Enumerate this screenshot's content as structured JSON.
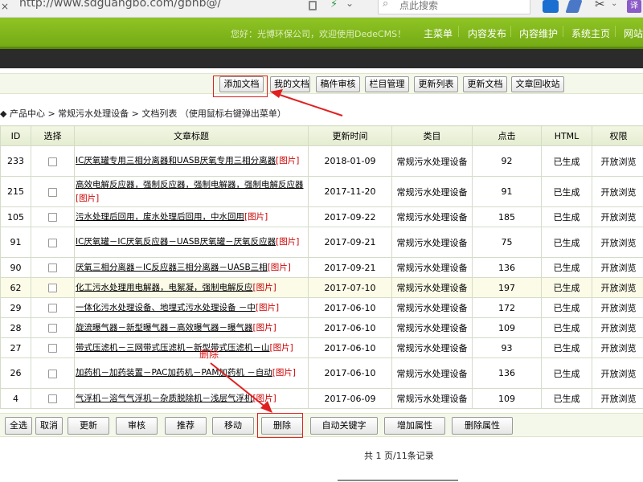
{
  "browser": {
    "url": "http://www.sdguangbo.com/gbhb@/",
    "search_placeholder": "点此搜索",
    "ext_translate": "译"
  },
  "header": {
    "welcome": "您好：光博环保公司，欢迎使用DedeCMS！",
    "nav": [
      "主菜单",
      "内容发布",
      "内容维护",
      "系统主页",
      "网站"
    ]
  },
  "toolbar": {
    "buttons": [
      "添加文档",
      "我的文档",
      "稿件审核",
      "栏目管理",
      "更新列表",
      "更新文档",
      "文章回收站"
    ]
  },
  "breadcrumb": {
    "text": "◆ 产品中心 > 常规污水处理设备 > 文档列表 （使用鼠标右键弹出菜单）"
  },
  "table": {
    "headers": [
      "ID",
      "选择",
      "文章标题",
      "更新时间",
      "类目",
      "点击",
      "HTML",
      "权限"
    ],
    "img_tag": "[图片]",
    "rows": [
      {
        "id": "233",
        "title": "IC厌氧罐专用三相分离器和UASB厌氧专用三相分离器",
        "date": "2018-01-09",
        "cat": "常规污水处理设备",
        "clicks": "92",
        "html": "已生成",
        "perm": "开放浏览"
      },
      {
        "id": "215",
        "title": "高效电解反应器，强制反应器，强制电解器，强制电解反应器",
        "date": "2017-11-20",
        "cat": "常规污水处理设备",
        "clicks": "91",
        "html": "已生成",
        "perm": "开放浏览"
      },
      {
        "id": "105",
        "title": "污水处理后回用，废水处理后回用，中水回用",
        "date": "2017-09-22",
        "cat": "常规污水处理设备",
        "clicks": "185",
        "html": "已生成",
        "perm": "开放浏览"
      },
      {
        "id": "91",
        "title": "IC厌氧罐－IC厌氧反应器－UASB厌氧罐－厌氧反应器",
        "date": "2017-09-21",
        "cat": "常规污水处理设备",
        "clicks": "75",
        "html": "已生成",
        "perm": "开放浏览"
      },
      {
        "id": "90",
        "title": "厌氧三相分离器－IC反应器三相分离器－UASB三相",
        "date": "2017-09-21",
        "cat": "常规污水处理设备",
        "clicks": "136",
        "html": "已生成",
        "perm": "开放浏览"
      },
      {
        "id": "62",
        "title": "化工污水处理用电解器，电絮凝，强制电解反应",
        "date": "2017-07-10",
        "cat": "常规污水处理设备",
        "clicks": "197",
        "html": "已生成",
        "perm": "开放浏览"
      },
      {
        "id": "29",
        "title": "一体化污水处理设备、地埋式污水处理设备 －中",
        "date": "2017-06-10",
        "cat": "常规污水处理设备",
        "clicks": "172",
        "html": "已生成",
        "perm": "开放浏览"
      },
      {
        "id": "28",
        "title": "旋流曝气器－新型曝气器－高效曝气器－曝气器",
        "date": "2017-06-10",
        "cat": "常规污水处理设备",
        "clicks": "109",
        "html": "已生成",
        "perm": "开放浏览"
      },
      {
        "id": "27",
        "title": "带式压滤机－三网带式压滤机－新型带式压滤机－山",
        "date": "2017-06-10",
        "cat": "常规污水处理设备",
        "clicks": "93",
        "html": "已生成",
        "perm": "开放浏览"
      },
      {
        "id": "26",
        "title": "加药机－加药装置－PAC加药机－PAM加药机 －自动",
        "date": "2017-06-10",
        "cat": "常规污水处理设备",
        "clicks": "136",
        "html": "已生成",
        "perm": "开放浏览"
      },
      {
        "id": "4",
        "title": "气浮机－溶气气浮机－杂质脱除机－浅层气浮机",
        "date": "2017-06-09",
        "cat": "常规污水处理设备",
        "clicks": "109",
        "html": "已生成",
        "perm": "开放浏览"
      }
    ]
  },
  "bottom_buttons": [
    "全选",
    "取消",
    "更新",
    "审核",
    "推荐",
    "移动",
    "删除",
    "自动关键字",
    "增加属性",
    "删除属性"
  ],
  "pager": "共 1 页/11条记录",
  "annotation": {
    "text": "删除"
  },
  "colors": {
    "header_green": "#8ec424",
    "annotation_red": "#e02020",
    "image_tag_red": "#cc0000"
  }
}
